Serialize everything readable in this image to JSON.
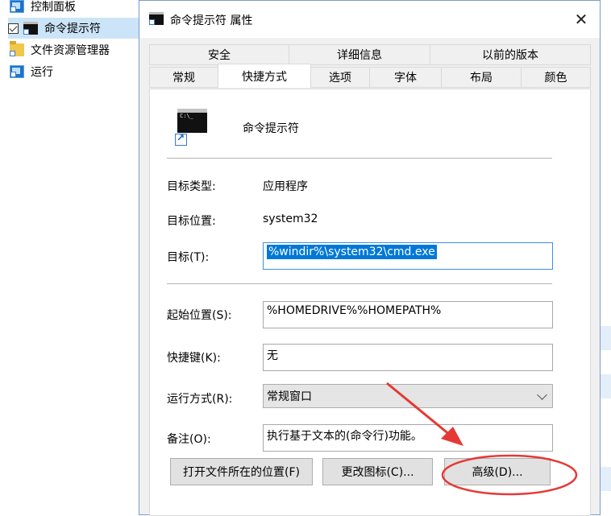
{
  "explorer": {
    "nav_items": [
      {
        "label": "控制面板",
        "icon": "control-panel-icon"
      },
      {
        "label": "命令提示符",
        "icon": "cmd-icon",
        "selected": true
      },
      {
        "label": "文件资源管理器",
        "icon": "folder-icon"
      },
      {
        "label": "运行",
        "icon": "run-icon"
      }
    ]
  },
  "dialog": {
    "title": "命令提示符 属性",
    "close_glyph": "✕",
    "tabs_row1": [
      "安全",
      "详细信息",
      "以前的版本"
    ],
    "tabs_row2": [
      "常规",
      "快捷方式",
      "选项",
      "字体",
      "布局",
      "颜色"
    ],
    "active_tab": "快捷方式",
    "shortcut_name": "命令提示符",
    "target_type_label": "目标类型:",
    "target_type_value": "应用程序",
    "target_location_label": "目标位置:",
    "target_location_value": "system32",
    "target_label": "目标(T):",
    "target_value": "%windir%\\system32\\cmd.exe",
    "start_in_label": "起始位置(S):",
    "start_in_value": "%HOMEDRIVE%%HOMEPATH%",
    "hotkey_label": "快捷键(K):",
    "hotkey_value": "无",
    "run_label": "运行方式(R):",
    "run_value": "常规窗口",
    "comment_label": "备注(O):",
    "comment_value": "执行基于文本的(命令行)功能。",
    "buttons": {
      "open_location": "打开文件所在的位置(F)",
      "change_icon": "更改图标(C)...",
      "advanced": "高级(D)..."
    }
  },
  "colors": {
    "annotation_red": "#e53935",
    "selection_blue": "#0078d7",
    "focus_border": "#3c8ee8"
  }
}
